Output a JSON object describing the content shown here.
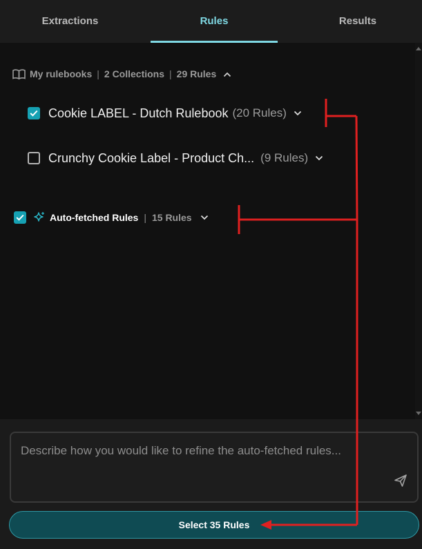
{
  "tabs": [
    {
      "label": "Extractions"
    },
    {
      "label": "Rules",
      "active": true
    },
    {
      "label": "Results"
    }
  ],
  "rulebooks": {
    "header": {
      "icon": "open-book-icon",
      "title": "My rulebooks",
      "collections": "2 Collections",
      "rules": "29 Rules"
    },
    "items": [
      {
        "title": "Cookie LABEL - Dutch Rulebook",
        "count": "(20 Rules)",
        "checked": true
      },
      {
        "title": "Crunchy Cookie Label - Product Ch...",
        "count": "(9 Rules)",
        "checked": false
      }
    ]
  },
  "auto_fetched": {
    "icon": "sparkle-icon",
    "label": "Auto-fetched Rules",
    "count": "15 Rules",
    "checked": true
  },
  "refine": {
    "placeholder": "Describe how you would like to refine the auto-fetched rules..."
  },
  "select_button": {
    "label": "Select 35 Rules"
  },
  "colors": {
    "accent": "#7fd8e3",
    "checkbox": "#16a1b3",
    "button_bg": "#0f4b53",
    "annotation": "#e02020"
  }
}
